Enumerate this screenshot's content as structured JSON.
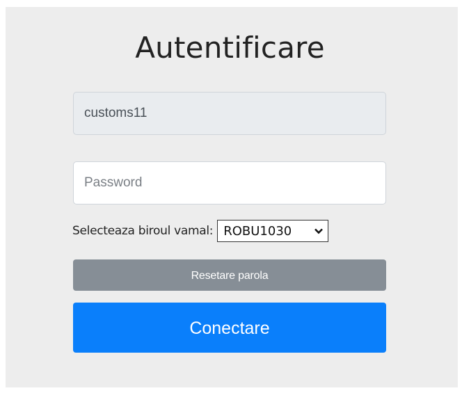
{
  "login": {
    "title": "Autentificare",
    "username_value": "customs11",
    "password_placeholder": "Password",
    "office_label": "Selecteaza biroul vamal:",
    "office_selected": "ROBU1030",
    "reset_label": "Resetare parola",
    "connect_label": "Conectare"
  },
  "colors": {
    "panel_bg": "#ededed",
    "reset_button": "#868e96",
    "connect_button": "#0a7ffb",
    "username_field_bg": "#e9ecef"
  },
  "icons": {
    "select_arrow": "chevron-down-icon"
  }
}
